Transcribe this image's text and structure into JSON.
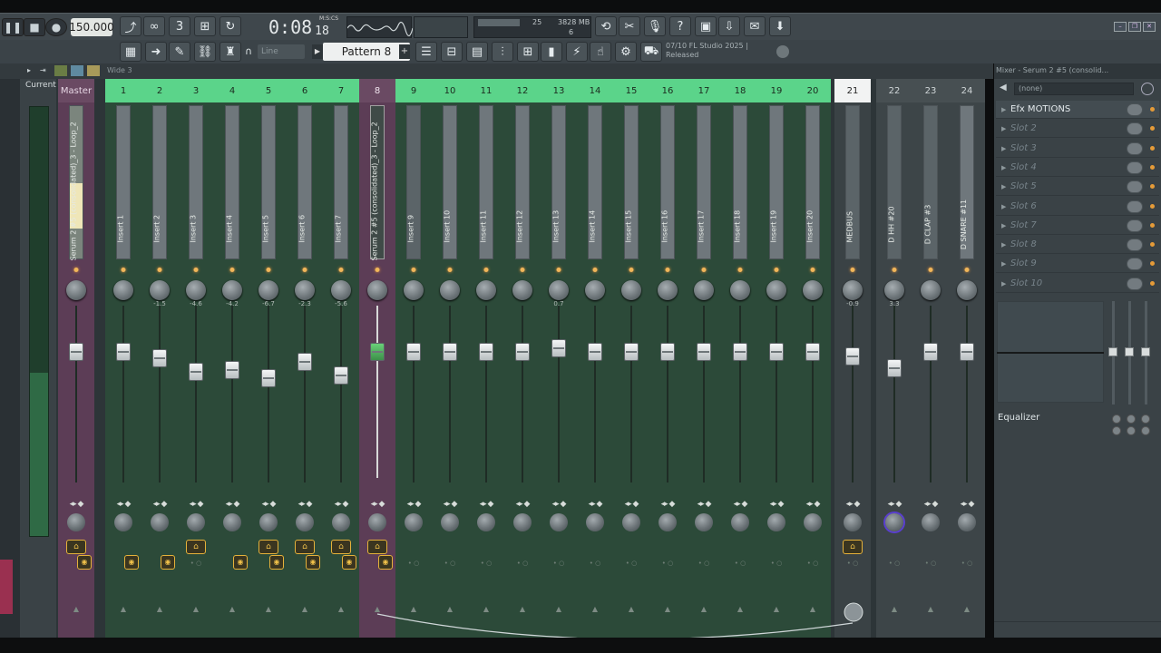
{
  "toolbar": {
    "tempo": "150.000",
    "time_main": "0:08",
    "time_small": "18",
    "time_format": "M:S:CS",
    "cpu_text": "25",
    "mem_text": "3828 MB",
    "voices": "6",
    "pattern": "Pattern 8",
    "snap": "Line",
    "news_line1": "07/10  FL Studio 2025 |",
    "news_line2": "Released"
  },
  "mixer": {
    "header_label": "Wide 3",
    "current_label": "Current",
    "title": "Mixer - Serum 2 #5 (consolid..."
  },
  "channels": [
    {
      "num": "Master",
      "name": "Serum 2 #5 (consolidated)_3 - Loop_2",
      "knob": "",
      "master": true
    },
    {
      "num": "1",
      "name": "Insert 1",
      "knob": ""
    },
    {
      "num": "2",
      "name": "Insert 2",
      "knob": "-1.5"
    },
    {
      "num": "3",
      "name": "Insert 3",
      "knob": "-4.6"
    },
    {
      "num": "4",
      "name": "Insert 4",
      "knob": "-4.2"
    },
    {
      "num": "5",
      "name": "Insert 5",
      "knob": "-6.7"
    },
    {
      "num": "6",
      "name": "Insert 6",
      "knob": "-2.3"
    },
    {
      "num": "7",
      "name": "Insert 7",
      "knob": "-5.6"
    },
    {
      "num": "8",
      "name": "Serum 2 #5 (consolidated)_3 - Loop_2",
      "knob": "",
      "selected": true
    },
    {
      "num": "9",
      "name": "Insert 9",
      "knob": ""
    },
    {
      "num": "10",
      "name": "Insert 10",
      "knob": ""
    },
    {
      "num": "11",
      "name": "Insert 11",
      "knob": ""
    },
    {
      "num": "12",
      "name": "Insert 12",
      "knob": ""
    },
    {
      "num": "13",
      "name": "Insert 13",
      "knob": "0.7"
    },
    {
      "num": "14",
      "name": "Insert 14",
      "knob": ""
    },
    {
      "num": "15",
      "name": "Insert 15",
      "knob": ""
    },
    {
      "num": "16",
      "name": "Insert 16",
      "knob": ""
    },
    {
      "num": "17",
      "name": "Insert 17",
      "knob": ""
    },
    {
      "num": "18",
      "name": "Insert 18",
      "knob": ""
    },
    {
      "num": "19",
      "name": "Insert 19",
      "knob": ""
    },
    {
      "num": "20",
      "name": "Insert 20",
      "knob": ""
    },
    {
      "num": "21",
      "name": "MEDBUS",
      "knob": "-0.9",
      "bus": true
    },
    {
      "num": "22",
      "name": "D HH #20",
      "knob": "3.3",
      "grey": true
    },
    {
      "num": "23",
      "name": "D CLAP #3",
      "knob": "",
      "grey": true
    },
    {
      "num": "24",
      "name": "D SNARE #11",
      "knob": "",
      "grey": true
    }
  ],
  "fader_levels": [
    0.78,
    0.78,
    0.74,
    0.66,
    0.67,
    0.62,
    0.72,
    0.64,
    0.78,
    0.78,
    0.78,
    0.78,
    0.78,
    0.8,
    0.78,
    0.78,
    0.78,
    0.78,
    0.78,
    0.78,
    0.78,
    0.75,
    0.68,
    0.78,
    0.78
  ],
  "effects": {
    "preset": "(none)",
    "slots": [
      "Efx MOTIONS",
      "Slot 2",
      "Slot 3",
      "Slot 4",
      "Slot 5",
      "Slot 6",
      "Slot 7",
      "Slot 8",
      "Slot 9",
      "Slot 10"
    ],
    "eq_label": "Equalizer"
  },
  "colors": {
    "insert_header": "#5bd48a",
    "selected_strip": "#5c3d56",
    "strip_bg": "#2c4a39",
    "grey_strip": "#3d4548",
    "accent": "#e5b13a"
  }
}
